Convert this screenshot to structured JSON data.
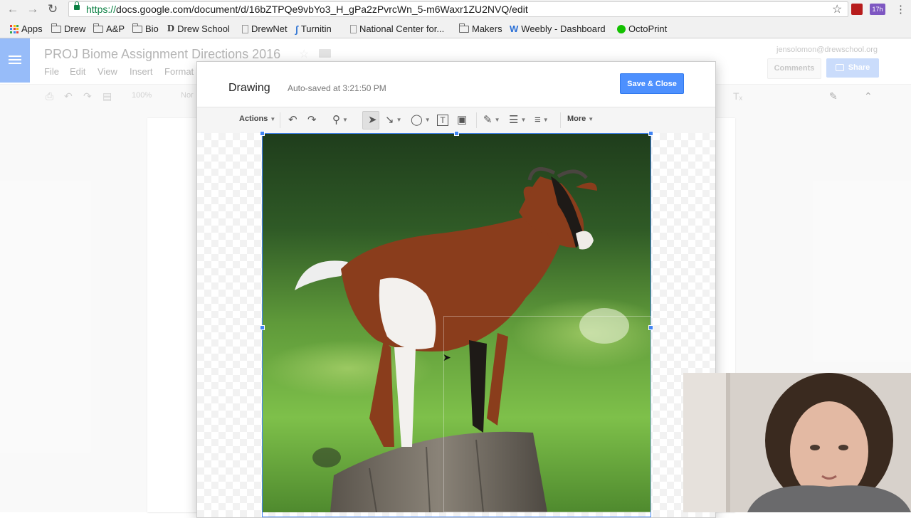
{
  "browser": {
    "url_scheme": "https://",
    "url_rest": "docs.google.com/document/d/16bZTPQe9vbYo3_H_gPa2zPvrcWn_5-m6Waxr1ZU2NVQ/edit",
    "extension_badge": "17h"
  },
  "bookmarks": [
    {
      "label": "Apps",
      "icon": "apps-grid-icon"
    },
    {
      "label": "Drew",
      "icon": "folder-icon"
    },
    {
      "label": "A&P",
      "icon": "folder-icon"
    },
    {
      "label": "Bio",
      "icon": "folder-icon"
    },
    {
      "label": "Drew School",
      "icon": "drew-school-icon"
    },
    {
      "label": "DrewNet",
      "icon": "page-icon"
    },
    {
      "label": "Turnitin",
      "icon": "turnitin-icon"
    },
    {
      "label": "National Center for...",
      "icon": "page-icon"
    },
    {
      "label": "Makers",
      "icon": "folder-icon"
    },
    {
      "label": "Weebly - Dashboard",
      "icon": "weebly-icon"
    },
    {
      "label": "OctoPrint",
      "icon": "octoprint-icon"
    }
  ],
  "docs": {
    "title": "PROJ Biome Assignment Directions 2016",
    "menu": [
      "File",
      "Edit",
      "View",
      "Insert",
      "Format"
    ],
    "zoom": "100%",
    "style_partial": "Nor",
    "user_email": "jensolomon@drewschool.org",
    "comments_label": "Comments",
    "share_label": "Share"
  },
  "drawing": {
    "title": "Drawing",
    "autosave": "Auto-saved at 3:21:50 PM",
    "save_close_label": "Save & Close",
    "actions_label": "Actions",
    "more_label": "More"
  },
  "colors": {
    "accent_blue": "#4285f4",
    "save_button": "#4d90fe",
    "docs_blue": "#4285f4",
    "secure_green": "#0b8043"
  }
}
